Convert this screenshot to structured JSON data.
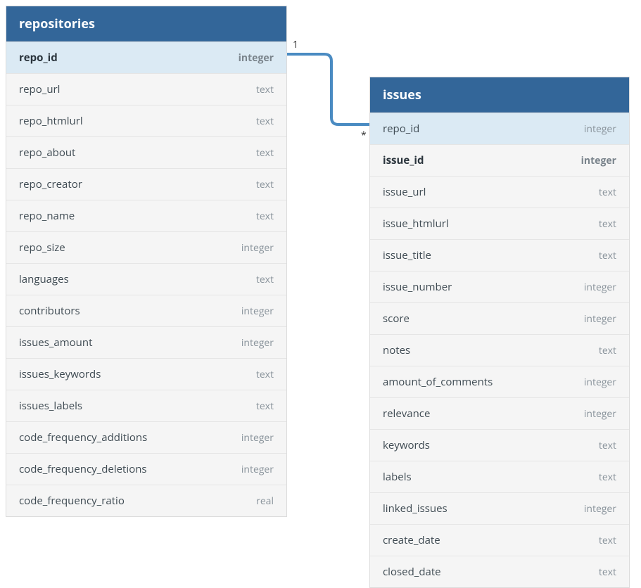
{
  "tables": {
    "repositories": {
      "title": "repositories",
      "columns": [
        {
          "name": "repo_id",
          "type": "integer",
          "pk": true,
          "fk": false
        },
        {
          "name": "repo_url",
          "type": "text",
          "pk": false,
          "fk": false
        },
        {
          "name": "repo_htmlurl",
          "type": "text",
          "pk": false,
          "fk": false
        },
        {
          "name": "repo_about",
          "type": "text",
          "pk": false,
          "fk": false
        },
        {
          "name": "repo_creator",
          "type": "text",
          "pk": false,
          "fk": false
        },
        {
          "name": "repo_name",
          "type": "text",
          "pk": false,
          "fk": false
        },
        {
          "name": "repo_size",
          "type": "integer",
          "pk": false,
          "fk": false
        },
        {
          "name": "languages",
          "type": "text",
          "pk": false,
          "fk": false
        },
        {
          "name": "contributors",
          "type": "integer",
          "pk": false,
          "fk": false
        },
        {
          "name": "issues_amount",
          "type": "integer",
          "pk": false,
          "fk": false
        },
        {
          "name": "issues_keywords",
          "type": "text",
          "pk": false,
          "fk": false
        },
        {
          "name": "issues_labels",
          "type": "text",
          "pk": false,
          "fk": false
        },
        {
          "name": "code_frequency_additions",
          "type": "integer",
          "pk": false,
          "fk": false
        },
        {
          "name": "code_frequency_deletions",
          "type": "integer",
          "pk": false,
          "fk": false
        },
        {
          "name": "code_frequency_ratio",
          "type": "real",
          "pk": false,
          "fk": false
        }
      ]
    },
    "issues": {
      "title": "issues",
      "columns": [
        {
          "name": "repo_id",
          "type": "integer",
          "pk": false,
          "fk": true
        },
        {
          "name": "issue_id",
          "type": "integer",
          "pk": true,
          "fk": false
        },
        {
          "name": "issue_url",
          "type": "text",
          "pk": false,
          "fk": false
        },
        {
          "name": "issue_htmlurl",
          "type": "text",
          "pk": false,
          "fk": false
        },
        {
          "name": "issue_title",
          "type": "text",
          "pk": false,
          "fk": false
        },
        {
          "name": "issue_number",
          "type": "integer",
          "pk": false,
          "fk": false
        },
        {
          "name": "score",
          "type": "integer",
          "pk": false,
          "fk": false
        },
        {
          "name": "notes",
          "type": "text",
          "pk": false,
          "fk": false
        },
        {
          "name": "amount_of_comments",
          "type": "integer",
          "pk": false,
          "fk": false
        },
        {
          "name": "relevance",
          "type": "integer",
          "pk": false,
          "fk": false
        },
        {
          "name": "keywords",
          "type": "text",
          "pk": false,
          "fk": false
        },
        {
          "name": "labels",
          "type": "text",
          "pk": false,
          "fk": false
        },
        {
          "name": "linked_issues",
          "type": "integer",
          "pk": false,
          "fk": false
        },
        {
          "name": "create_date",
          "type": "text",
          "pk": false,
          "fk": false
        },
        {
          "name": "closed_date",
          "type": "text",
          "pk": false,
          "fk": false
        }
      ]
    }
  },
  "relationship": {
    "from_cardinality": "1",
    "to_cardinality": "*"
  }
}
